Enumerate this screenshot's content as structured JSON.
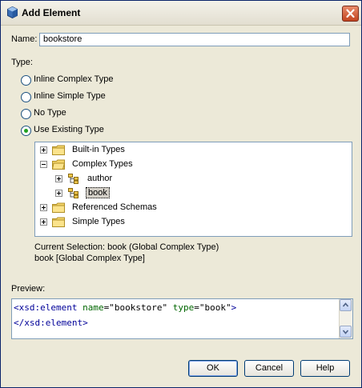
{
  "window": {
    "title": "Add Element"
  },
  "name_field": {
    "label": "Name:",
    "value": "bookstore"
  },
  "type_section": {
    "label": "Type:",
    "options": [
      {
        "label": "Inline Complex Type",
        "selected": false
      },
      {
        "label": "Inline Simple Type",
        "selected": false
      },
      {
        "label": "No Type",
        "selected": false
      },
      {
        "label": "Use Existing Type",
        "selected": true
      }
    ]
  },
  "tree": {
    "nodes": [
      {
        "label": "Built-in Types",
        "expanded": false,
        "level": 0
      },
      {
        "label": "Complex Types",
        "expanded": true,
        "level": 0
      },
      {
        "label": "author",
        "expanded": false,
        "level": 1
      },
      {
        "label": "book",
        "expanded": false,
        "level": 1,
        "selected": true
      },
      {
        "label": "Referenced Schemas",
        "expanded": false,
        "level": 0
      },
      {
        "label": "Simple Types",
        "expanded": false,
        "level": 0
      }
    ]
  },
  "selection": {
    "current": "Current Selection: book (Global Complex Type)",
    "detail": "book [Global Complex Type]"
  },
  "preview": {
    "label": "Preview:",
    "line1": {
      "open": "<xsd:element",
      "attr1": "name",
      "val1": "=\"bookstore\"",
      "attr2": "type",
      "val2": "=\"book\"",
      "close": ">"
    },
    "line2": "</xsd:element>"
  },
  "buttons": {
    "ok": "OK",
    "cancel": "Cancel",
    "help": "Help"
  },
  "colors": {
    "accent_radio": "#21a121",
    "title_border": "#0a246a",
    "folder": "#f5d56a"
  }
}
